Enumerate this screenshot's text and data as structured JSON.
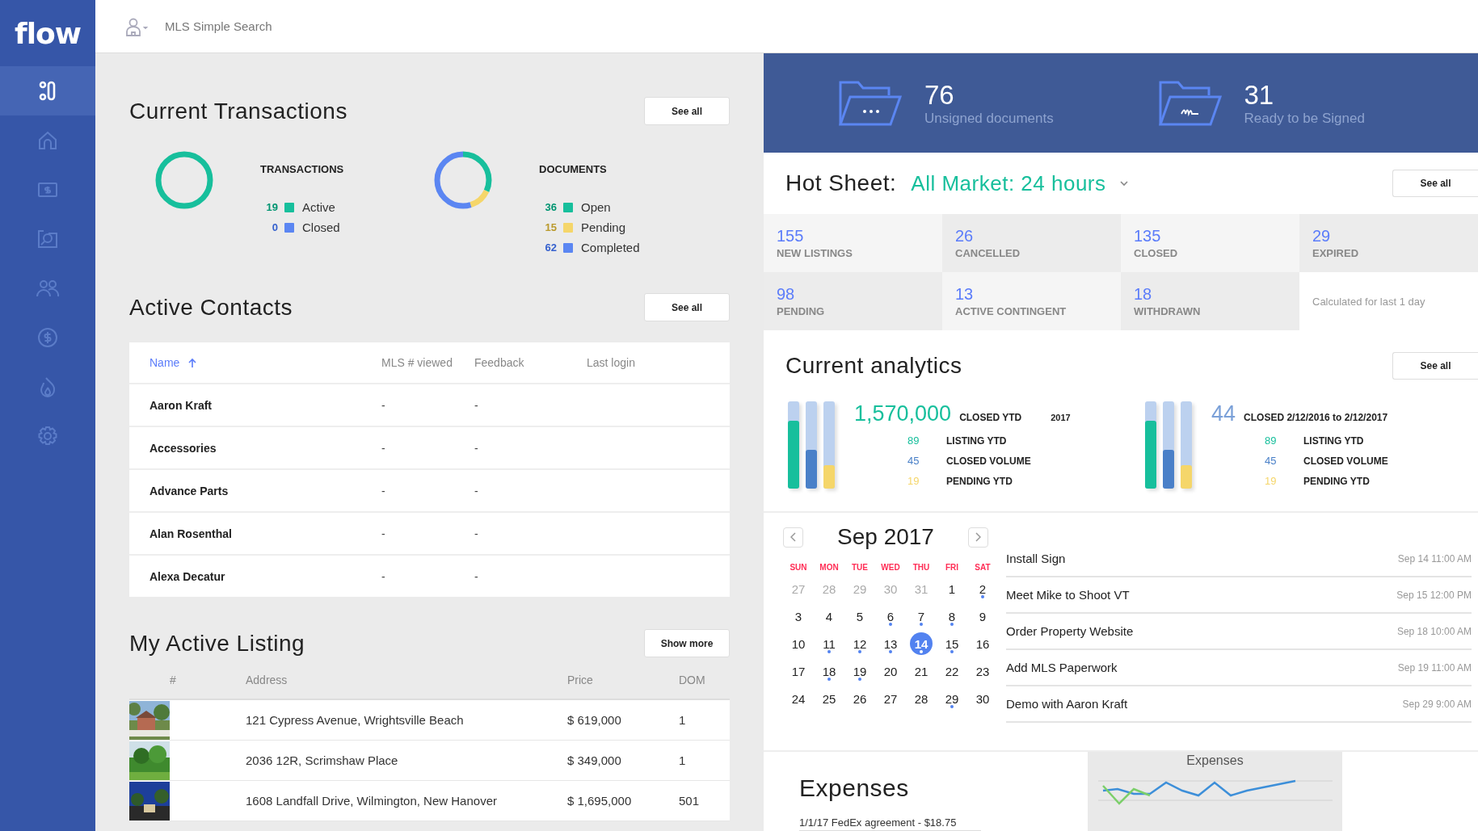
{
  "sidebar": {
    "logo": "flow",
    "items": [
      {
        "kind": "dashboard",
        "selected": true
      },
      {
        "kind": "home",
        "selected": false
      },
      {
        "kind": "money",
        "selected": false
      },
      {
        "kind": "photo-search",
        "selected": false
      },
      {
        "kind": "people",
        "selected": false
      },
      {
        "kind": "dollar",
        "selected": false
      },
      {
        "kind": "flame",
        "selected": false
      },
      {
        "kind": "gear",
        "selected": false
      }
    ]
  },
  "header": {
    "breadcrumb": "MLS Simple Search"
  },
  "current_transactions": {
    "title": "Current Transactions",
    "button": "See all",
    "groups": [
      {
        "title": "TRANSACTIONS",
        "items": [
          {
            "count": "19",
            "label": "Active",
            "color": "#17bf9c"
          },
          {
            "count": "0",
            "label": "Closed",
            "color": "#5b86f2"
          }
        ]
      },
      {
        "title": "DOCUMENTS",
        "items": [
          {
            "count": "36",
            "label": "Open",
            "color": "#17bf9c"
          },
          {
            "count": "15",
            "label": "Pending",
            "color": "#f5d66a"
          },
          {
            "count": "62",
            "label": "Completed",
            "color": "#5b86f2"
          }
        ]
      }
    ]
  },
  "active_contacts": {
    "title": "Active Contacts",
    "button": "See all",
    "columns": [
      {
        "label": "Name",
        "sorted": true
      },
      {
        "label": "MLS # viewed",
        "sorted": false
      },
      {
        "label": "Feedback",
        "sorted": false
      },
      {
        "label": "Last login",
        "sorted": false
      }
    ],
    "rows": [
      {
        "name": "Aaron Kraft",
        "mls_viewed": "-",
        "feedback": "-"
      },
      {
        "name": "Accessories",
        "mls_viewed": "-",
        "feedback": "-"
      },
      {
        "name": "Advance Parts",
        "mls_viewed": "-",
        "feedback": "-"
      },
      {
        "name": "Alan Rosenthal",
        "mls_viewed": "-",
        "feedback": "-"
      },
      {
        "name": "Alexa Decatur",
        "mls_viewed": "-",
        "feedback": "-"
      }
    ]
  },
  "active_listing": {
    "title": "My Active Listing",
    "button": "Show more",
    "columns": [
      "#",
      "Address",
      "Price",
      "DOM"
    ],
    "rows": [
      {
        "kind": "picture",
        "address": "121 Cypress Avenue, Wrightsville Beach",
        "price": "$ 619,000",
        "dom": "1"
      },
      {
        "kind": "picture",
        "address": "2036 12R, Scrimshaw Place",
        "price": "$ 349,000",
        "dom": "1"
      },
      {
        "kind": "picture",
        "address": "1608 Landfall Drive, Wilmington, New Hanover",
        "price": "$ 1,695,000",
        "dom": "501"
      }
    ]
  },
  "documents": [
    {
      "kind": "dots",
      "count": "76",
      "label": "Unsigned documents"
    },
    {
      "kind": "signature",
      "count": "31",
      "label": "Ready to be Signed"
    }
  ],
  "hot_sheet": {
    "title": "Hot Sheet:",
    "filter": "All Market: 24 hours",
    "button": "See all",
    "stats": [
      {
        "value": "155",
        "label": "NEW LISTINGS"
      },
      {
        "value": "26",
        "label": "CANCELLED"
      },
      {
        "value": "135",
        "label": "CLOSED"
      },
      {
        "value": "29",
        "label": "EXPIRED"
      },
      {
        "value": "98",
        "label": "PENDING"
      },
      {
        "value": "13",
        "label": "ACTIVE CONTINGENT"
      },
      {
        "value": "18",
        "label": "WITHDRAWN"
      }
    ],
    "note": "Calculated for last 1 day"
  },
  "analytics": {
    "title": "Current analytics",
    "button": "See all",
    "groups": [
      {
        "value": "1,570,000",
        "color": "#17bf9c",
        "caption": "CLOSED YTD",
        "year": "2017",
        "bars": [
          {
            "level": 0.78,
            "color": "#17bf9c"
          },
          {
            "level": 0.44,
            "color": "#4a80c8"
          },
          {
            "level": 0.27,
            "color": "#f5d66a"
          }
        ],
        "rows": [
          {
            "value": "89",
            "label": "LISTING YTD",
            "color": "#17bf9c"
          },
          {
            "value": "45",
            "label": "CLOSED VOLUME",
            "color": "#4a80c8"
          },
          {
            "value": "19",
            "label": "PENDING YTD",
            "color": "#f5d66a"
          }
        ]
      },
      {
        "value": "44",
        "color": "#7aa0d8",
        "caption": "CLOSED 2/12/2016 to 2/12/2017",
        "bars": [
          {
            "level": 0.78,
            "color": "#17bf9c"
          },
          {
            "level": 0.44,
            "color": "#4a80c8"
          },
          {
            "level": 0.27,
            "color": "#f5d66a"
          }
        ],
        "rows": [
          {
            "value": "89",
            "label": "LISTING YTD",
            "color": "#17bf9c"
          },
          {
            "value": "45",
            "label": "CLOSED VOLUME",
            "color": "#4a80c8"
          },
          {
            "value": "19",
            "label": "PENDING YTD",
            "color": "#f5d66a"
          }
        ]
      }
    ]
  },
  "calendar": {
    "month": "Sep 2017",
    "weekdays": [
      "SUN",
      "MON",
      "TUE",
      "WED",
      "THU",
      "FRI",
      "SAT"
    ],
    "weeks": [
      [
        {
          "day": "27",
          "muted": true,
          "event": false,
          "selected": false
        },
        {
          "day": "28",
          "muted": true,
          "event": false,
          "selected": false
        },
        {
          "day": "29",
          "muted": true,
          "event": false,
          "selected": false
        },
        {
          "day": "30",
          "muted": true,
          "event": false,
          "selected": false
        },
        {
          "day": "31",
          "muted": true,
          "event": false,
          "selected": false
        },
        {
          "day": "1",
          "muted": false,
          "event": false,
          "selected": false
        },
        {
          "day": "2",
          "muted": false,
          "event": true,
          "selected": false
        }
      ],
      [
        {
          "day": "3",
          "muted": false,
          "event": false,
          "selected": false
        },
        {
          "day": "4",
          "muted": false,
          "event": false,
          "selected": false
        },
        {
          "day": "5",
          "muted": false,
          "event": false,
          "selected": false
        },
        {
          "day": "6",
          "muted": false,
          "event": true,
          "selected": false
        },
        {
          "day": "7",
          "muted": false,
          "event": true,
          "selected": false
        },
        {
          "day": "8",
          "muted": false,
          "event": true,
          "selected": false
        },
        {
          "day": "9",
          "muted": false,
          "event": false,
          "selected": false
        }
      ],
      [
        {
          "day": "10",
          "muted": false,
          "event": false,
          "selected": false
        },
        {
          "day": "11",
          "muted": false,
          "event": true,
          "selected": false
        },
        {
          "day": "12",
          "muted": false,
          "event": true,
          "selected": false
        },
        {
          "day": "13",
          "muted": false,
          "event": true,
          "selected": false
        },
        {
          "day": "14",
          "muted": false,
          "event": true,
          "selected": true
        },
        {
          "day": "15",
          "muted": false,
          "event": true,
          "selected": false
        },
        {
          "day": "16",
          "muted": false,
          "event": false,
          "selected": false
        }
      ],
      [
        {
          "day": "17",
          "muted": false,
          "event": false,
          "selected": false
        },
        {
          "day": "18",
          "muted": false,
          "event": true,
          "selected": false
        },
        {
          "day": "19",
          "muted": false,
          "event": true,
          "selected": false
        },
        {
          "day": "20",
          "muted": false,
          "event": false,
          "selected": false
        },
        {
          "day": "21",
          "muted": false,
          "event": false,
          "selected": false
        },
        {
          "day": "22",
          "muted": false,
          "event": false,
          "selected": false
        },
        {
          "day": "23",
          "muted": false,
          "event": false,
          "selected": false
        }
      ],
      [
        {
          "day": "24",
          "muted": false,
          "event": false,
          "selected": false
        },
        {
          "day": "25",
          "muted": false,
          "event": false,
          "selected": false
        },
        {
          "day": "26",
          "muted": false,
          "event": false,
          "selected": false
        },
        {
          "day": "27",
          "muted": false,
          "event": false,
          "selected": false
        },
        {
          "day": "28",
          "muted": false,
          "event": false,
          "selected": false
        },
        {
          "day": "29",
          "muted": false,
          "event": true,
          "selected": false
        },
        {
          "day": "30",
          "muted": false,
          "event": false,
          "selected": false
        }
      ]
    ]
  },
  "events": [
    {
      "title": "Install Sign",
      "time": "Sep 14 11:00 AM"
    },
    {
      "title": "Meet Mike to Shoot VT",
      "time": "Sep 15 12:00 PM"
    },
    {
      "title": "Order Property Website",
      "time": "Sep 18 10:00 AM"
    },
    {
      "title": "Add MLS Paperwork",
      "time": "Sep 19 11:00 AM"
    },
    {
      "title": "Demo with Aaron Kraft",
      "time": "Sep 29 9:00 AM"
    }
  ],
  "expenses": {
    "title": "Expenses",
    "entries": [
      "1/1/17 FedEx agreement - $18.75"
    ],
    "chart": {
      "title": "Expenses"
    }
  }
}
